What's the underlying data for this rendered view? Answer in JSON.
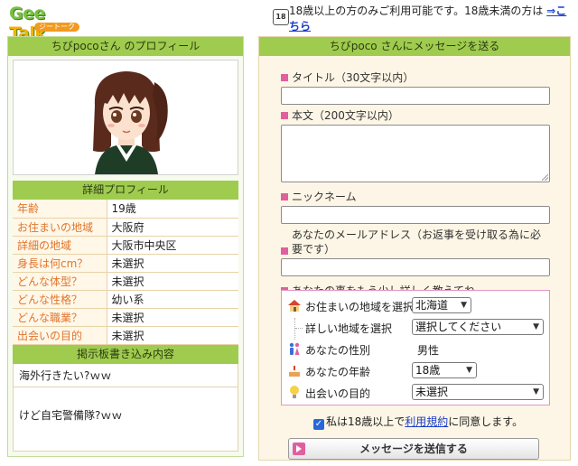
{
  "header": {
    "logo_text_1": "Gee",
    "logo_text_2": "Talk",
    "logo_sub": "ジートーク",
    "age_icon": "18",
    "age_notice": "18歳以上の方のみご利用可能です。18歳未満の方は",
    "age_link": "⇒こちら"
  },
  "profile": {
    "title": "ちびpocoさん のプロフィール",
    "detail_title": "詳細プロフィール",
    "rows": [
      {
        "label": "年齢",
        "value": "19歳"
      },
      {
        "label": "お住まいの地域",
        "value": "大阪府"
      },
      {
        "label": "詳細の地域",
        "value": "大阪市中央区"
      },
      {
        "label": "身長は何cm？",
        "value": "未選択"
      },
      {
        "label": "どんな体型？",
        "value": "未選択"
      },
      {
        "label": "どんな性格？",
        "value": "幼い系"
      },
      {
        "label": "どんな職業？",
        "value": "未選択"
      },
      {
        "label": "出会いの目的",
        "value": "未選択"
      }
    ],
    "board_title": "掲示板書き込み内容",
    "posts": [
      "海外行きたい?ｗｗ",
      "けど自宅警備隊?ｗｗ"
    ]
  },
  "message": {
    "title": "ちびpoco さんにメッセージを送る",
    "title_label": "タイトル（30文字以内）",
    "body_label": "本文（200文字以内）",
    "nickname_label": "ニックネーム",
    "email_label": "あなたのメールアドレス（お返事を受け取る為に必要です）",
    "more_label": "あなたの事をもう少し詳しく教えてね",
    "options": {
      "area_label": "お住まいの地域を選択",
      "area_value": "北海道",
      "detail_area_label": "詳しい地域を選択",
      "detail_area_value": "選択してください",
      "gender_label": "あなたの性別",
      "gender_value": "男性",
      "age_label": "あなたの年齢",
      "age_value": "18歳",
      "purpose_label": "出会いの目的",
      "purpose_value": "未選択"
    },
    "agree_prefix": "私は18歳以上で",
    "agree_link": "利用規約",
    "agree_suffix": "に同意します。",
    "send_label": "メッセージを送信する"
  },
  "colors": {
    "header_green": "#9fcc4e",
    "label_orange": "#e0752c",
    "accent_pink": "#e0609e",
    "link_blue": "#1a3cc8"
  }
}
